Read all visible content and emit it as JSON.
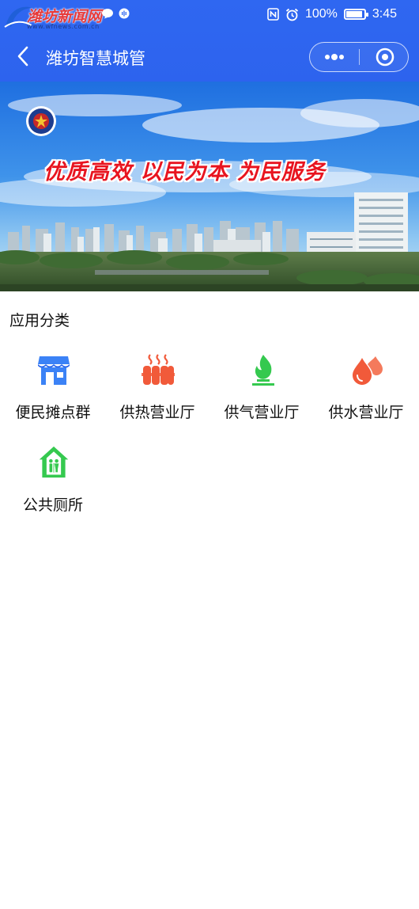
{
  "status_bar": {
    "watermark_name": "潍坊新闻网",
    "watermark_url": "www.wfnews.com.cn",
    "battery": "100%",
    "time": "3:45",
    "battery_level": 1.0
  },
  "navbar": {
    "title": "潍坊智慧城管",
    "back_icon": "chevron-left-icon",
    "more_icon": "more-dots-icon",
    "close_icon": "target-close-icon"
  },
  "banner": {
    "slogan": "优质高效 以民为本 为民服务"
  },
  "categories": {
    "title": "应用分类",
    "items": [
      {
        "label": "便民摊点群",
        "icon": "store-icon",
        "color": "#3b82f6"
      },
      {
        "label": "供热营业厅",
        "icon": "radiator-icon",
        "color": "#f15a3a"
      },
      {
        "label": "供气营业厅",
        "icon": "flame-icon",
        "color": "#35c94f"
      },
      {
        "label": "供水营业厅",
        "icon": "water-drop-icon",
        "color": "#f15a3a"
      },
      {
        "label": "公共厕所",
        "icon": "toilet-house-icon",
        "color": "#35c94f"
      }
    ]
  },
  "colors": {
    "header_bg": "#2f67f1",
    "slogan_red": "#e8141f"
  }
}
